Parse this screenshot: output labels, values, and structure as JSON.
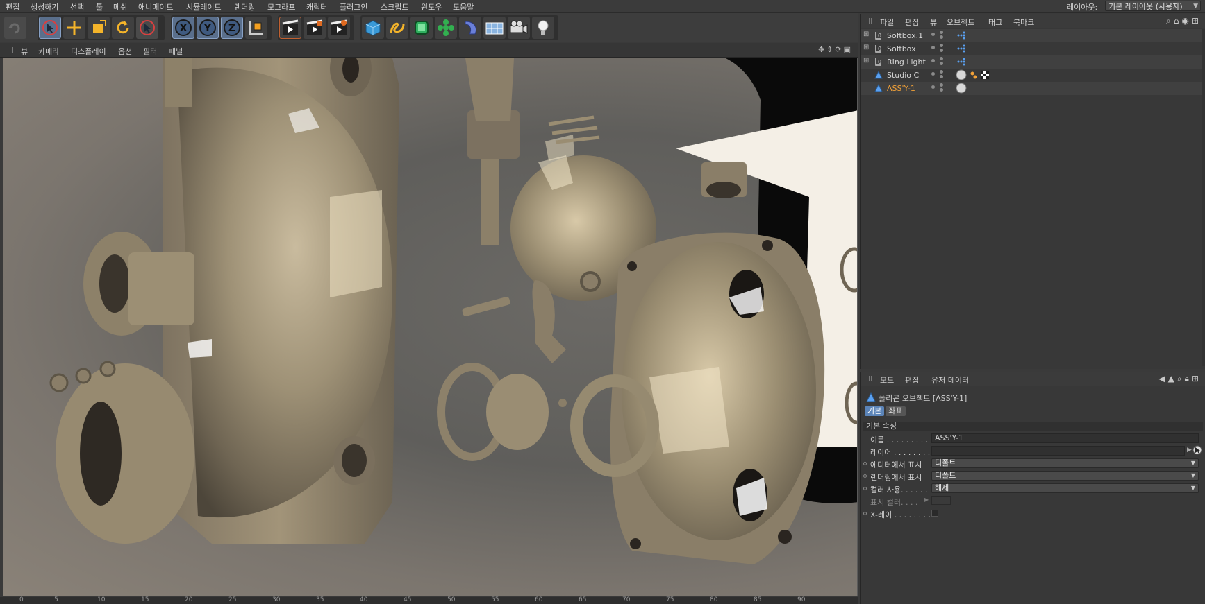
{
  "menu": [
    "편집",
    "생성하기",
    "선택",
    "툴",
    "메쉬",
    "애니메이트",
    "시뮬레이트",
    "렌더링",
    "모그라프",
    "캐릭터",
    "플러그인",
    "스크립트",
    "윈도우",
    "도움말"
  ],
  "layout": {
    "label": "레이아웃:",
    "value": "기본 레이아웃 (사용자)"
  },
  "toolbar": {
    "undo": "undo-icon",
    "tools": [
      "select-arrow-icon",
      "move-icon",
      "scale-icon",
      "rotate-icon",
      "live-select-icon"
    ],
    "axes": [
      "X",
      "Y",
      "Z"
    ],
    "coord": "world-coordinate-icon",
    "render": [
      "render-view-icon",
      "render-picture-viewer-icon",
      "render-settings-icon"
    ],
    "objects": [
      "cube-icon",
      "spline-pen-icon",
      "subdivision-icon",
      "mograph-cloner-icon",
      "deformer-icon",
      "floor-plane-icon",
      "camera-icon",
      "light-icon"
    ]
  },
  "viewport": {
    "menu": [
      "뷰",
      "카메라",
      "디스플레이",
      "옵션",
      "필터",
      "패널"
    ]
  },
  "timeline": {
    "ticks": [
      "0",
      "5",
      "10",
      "15",
      "20",
      "25",
      "30",
      "35",
      "40",
      "45",
      "50",
      "55",
      "60",
      "65",
      "70",
      "75",
      "80",
      "85",
      "90"
    ]
  },
  "object_manager": {
    "menu": [
      "파일",
      "편집",
      "뷰",
      "오브젝트",
      "태그",
      "북마크"
    ],
    "objects": [
      {
        "name": "Softbox.1",
        "type": "null",
        "active": false
      },
      {
        "name": "Softbox",
        "type": "null",
        "active": false
      },
      {
        "name": "RIng Light",
        "type": "null",
        "active": false
      },
      {
        "name": "Studio C",
        "type": "polygon",
        "active": false
      },
      {
        "name": "ASS'Y-1",
        "type": "polygon",
        "active": true
      }
    ]
  },
  "attribute_manager": {
    "menu": [
      "모드",
      "편집",
      "유저 데이터"
    ],
    "title": "폴리곤 오브젝트 [ASS'Y-1]",
    "tabs": [
      "기본",
      "좌표"
    ],
    "section": "기본 속성",
    "fields": {
      "name_label": "이름 . . . . . . . . . .",
      "name_value": "ASS'Y-1",
      "layer_label": "레이어 . . . . . . . .",
      "editor_label": "에디터에서 표시",
      "editor_value": "디폴트",
      "render_label": "렌더링에서 표시",
      "render_value": "디폴트",
      "color_label": "컬러 사용. . . . . .",
      "color_value": "해제",
      "display_color_label": "표시 컬러. . . .",
      "xray_label": "X-레이 . . . . . . . . ."
    }
  },
  "colors": {
    "accent": "#f0a038",
    "selected_tool": "#5a6f8c",
    "tab_active": "#5b84b8"
  }
}
